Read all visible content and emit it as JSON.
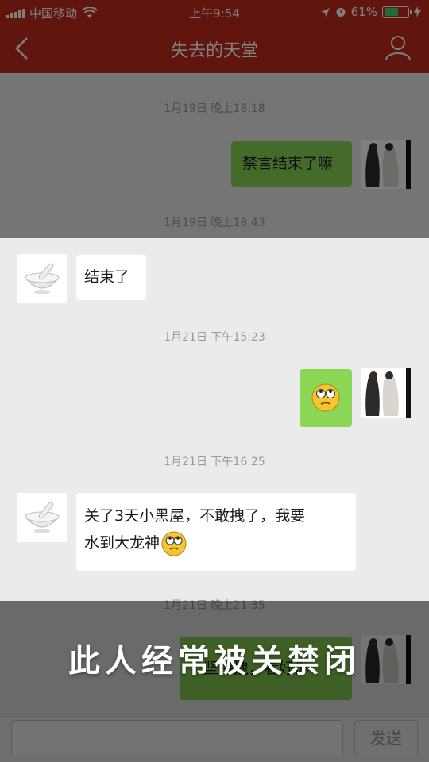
{
  "status_bar": {
    "carrier": "中国移动",
    "time": "上午9:54",
    "battery": "61%",
    "battery_level": 0.61
  },
  "nav": {
    "title": "失去的天堂",
    "back_icon": "chevron-left-icon",
    "profile_icon": "person-icon"
  },
  "messages": [
    {
      "type": "time",
      "text": "1月19日 晚上18:18"
    },
    {
      "type": "out",
      "text": "禁言结束了嘛"
    },
    {
      "type": "time",
      "text": "1月19日 晚上18:43"
    },
    {
      "type": "in",
      "text": "结束了"
    },
    {
      "type": "time",
      "text": "1月21日 下午15:23"
    },
    {
      "type": "out-emoji",
      "emoji": "rolling-eyes-emoji"
    },
    {
      "type": "time",
      "text": "1月21日 下午16:25"
    },
    {
      "type": "in",
      "line1": "关了3天小黑屋，不敢拽了，我要",
      "line2": "水到大龙神"
    },
    {
      "type": "time",
      "text": "1月21日 晚上21:35"
    },
    {
      "type": "out",
      "text": "坚持拽，看好你"
    }
  ],
  "input_bar": {
    "send_label": "发送"
  },
  "caption": "此人经常被关禁闭",
  "colors": {
    "header": "#c22a1f",
    "bubble_out": "#8bd655",
    "bubble_in": "#ffffff",
    "background": "#ebebeb"
  }
}
